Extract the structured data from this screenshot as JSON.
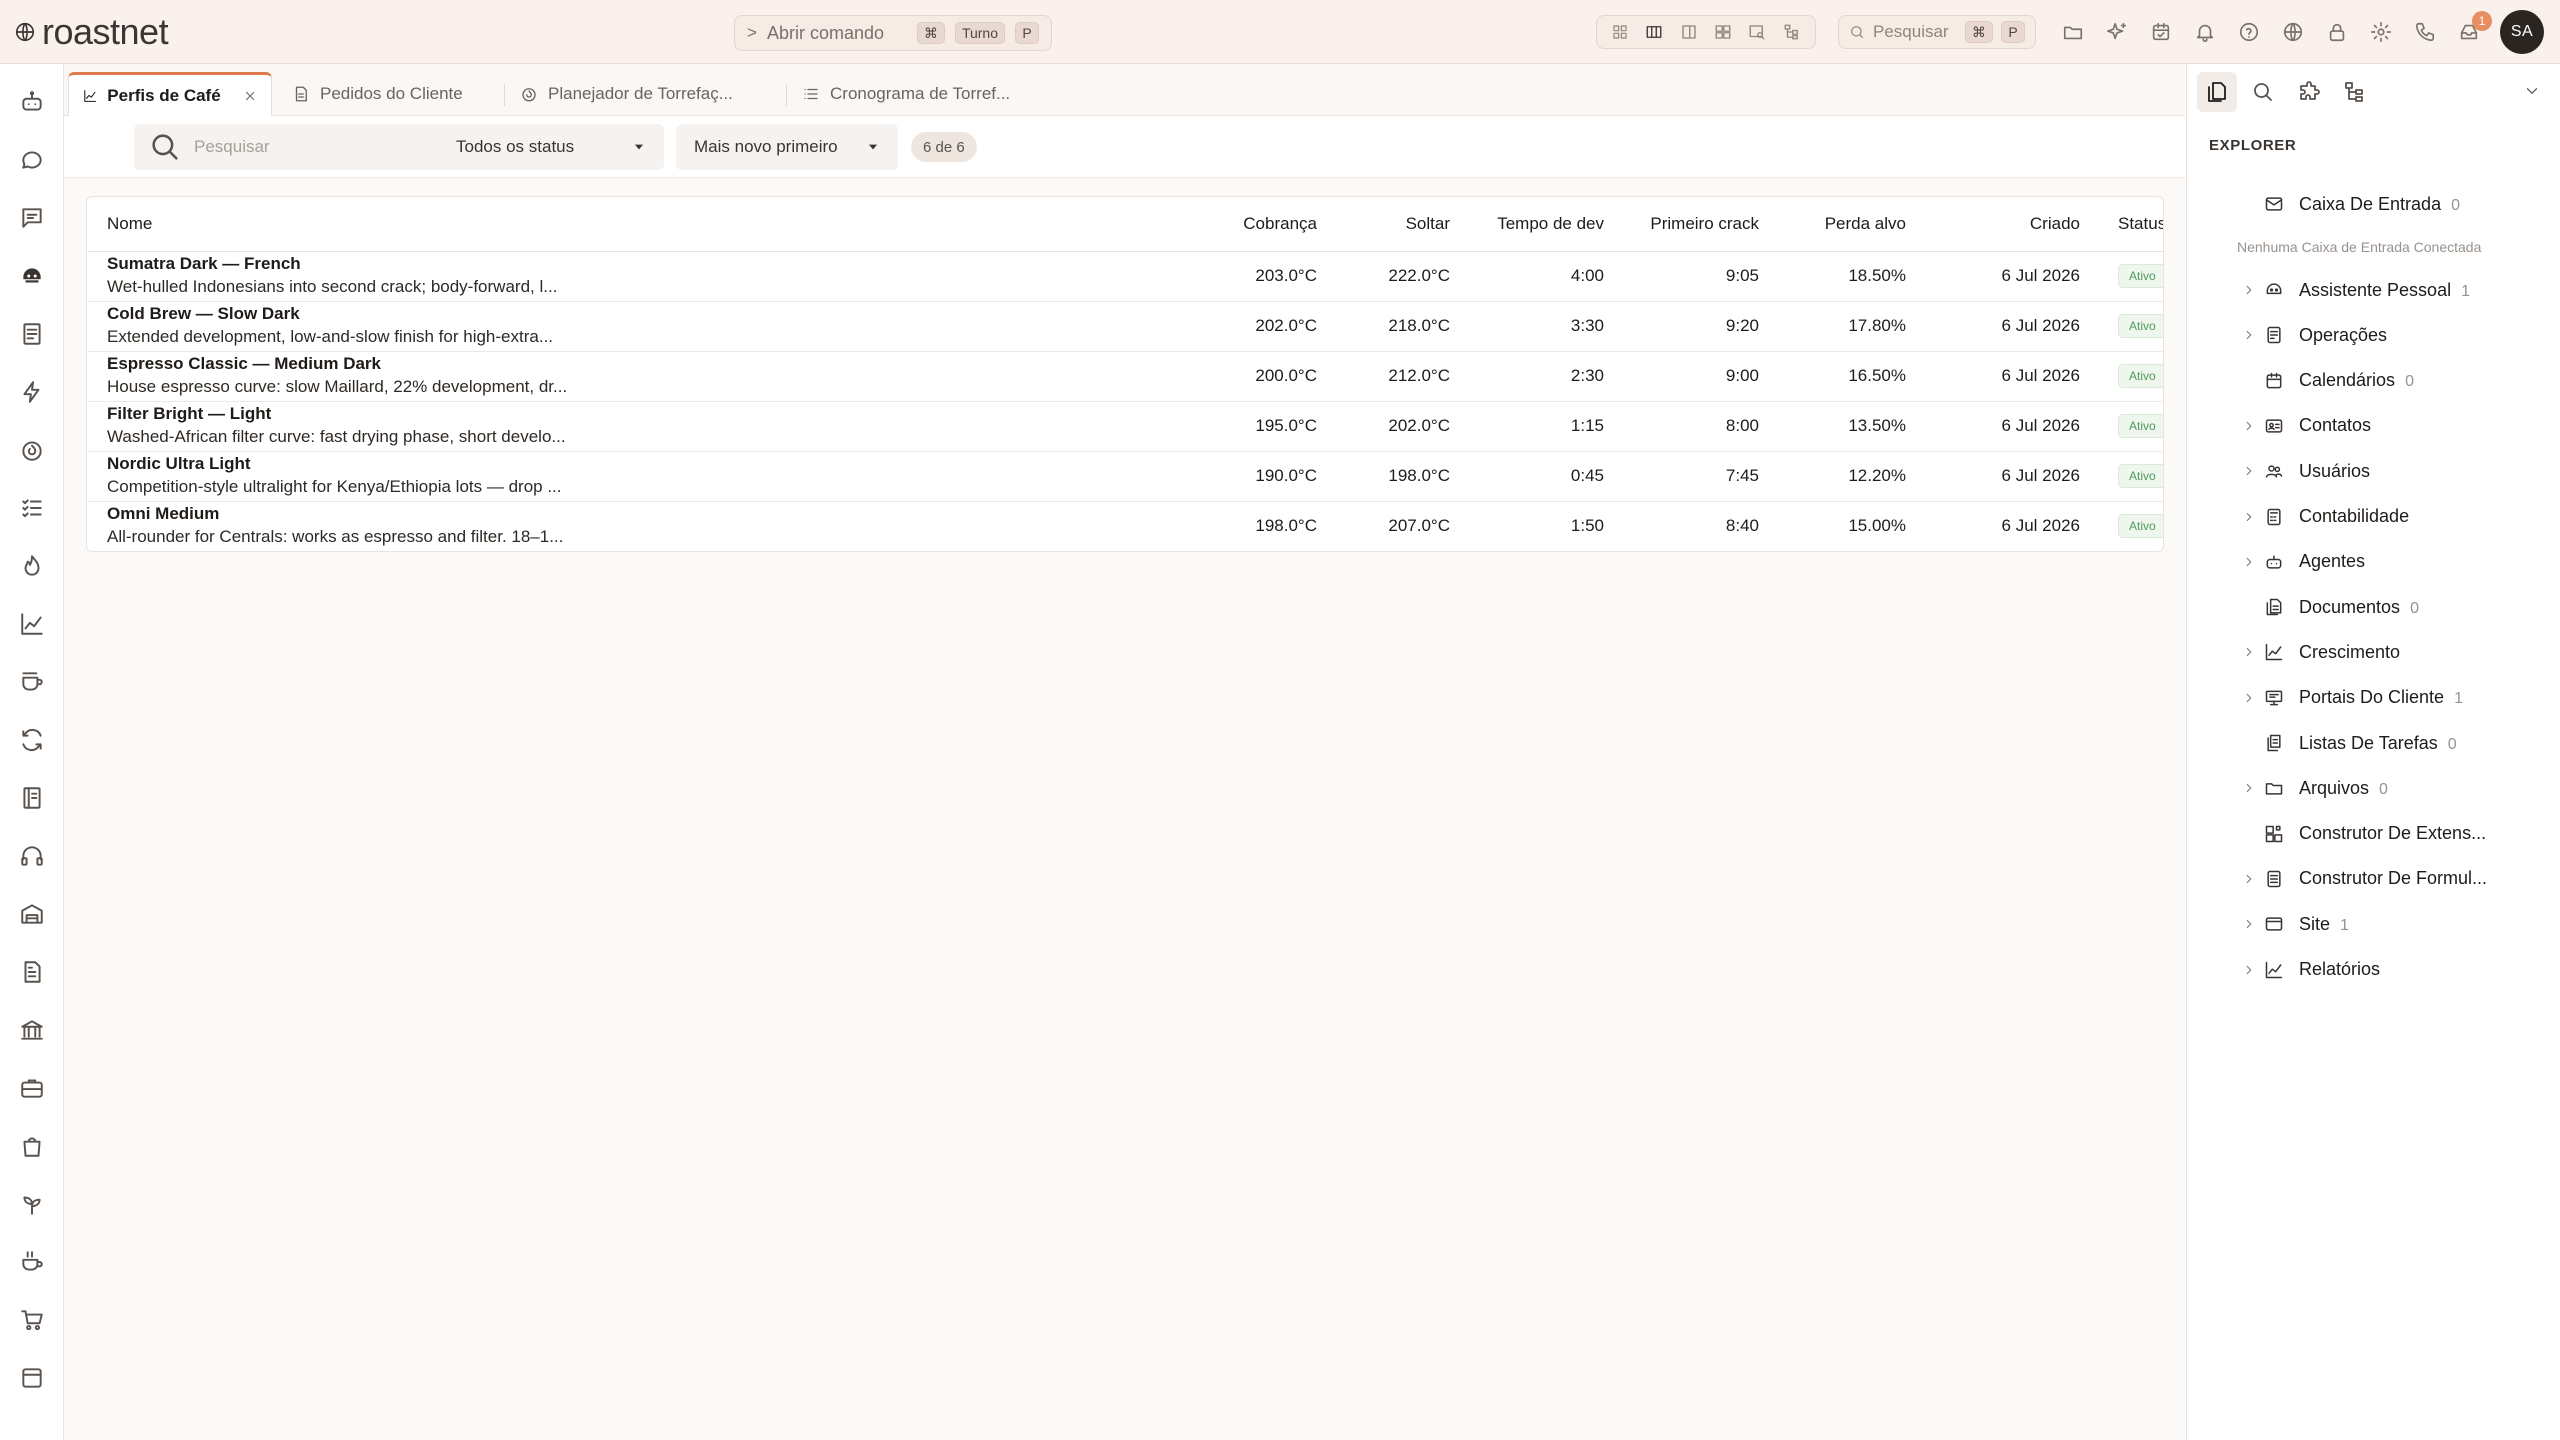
{
  "app": {
    "name": "roastnet",
    "brand_color": "#e07b4f",
    "user_initials": "SA",
    "notification_count": "1"
  },
  "command": {
    "prefix": ">",
    "label": "Abrir comando",
    "kbd1": "⌘",
    "kbd2": "Turno",
    "kbd3": "P"
  },
  "top_search": {
    "label": "Pesquisar",
    "kbd1": "⌘",
    "kbd2": "P"
  },
  "tabs": [
    {
      "label": "Perfis de Café",
      "icon": "chart-line-icon",
      "active": true
    },
    {
      "label": "Pedidos do Cliente",
      "icon": "document-icon",
      "active": false
    },
    {
      "label": "Planejador de Torrefaç...",
      "icon": "flame-icon",
      "active": false
    },
    {
      "label": "Cronograma de Torref...",
      "icon": "list-icon",
      "active": false
    }
  ],
  "filters": {
    "search_placeholder": "Pesquisar",
    "status_value": "Todos os status",
    "sort_value": "Mais novo primeiro",
    "count": "6 de 6"
  },
  "table": {
    "columns": [
      "Nome",
      "Cobrança",
      "Soltar",
      "Tempo de dev",
      "Primeiro crack",
      "Perda alvo",
      "Criado",
      "Status"
    ],
    "rows": [
      {
        "name": "Sumatra Dark — French",
        "desc": "Wet-hulled Indonesians into second crack; body-forward, l...",
        "charge": "203.0°C",
        "drop": "222.0°C",
        "dev": "4:00",
        "fc": "9:05",
        "loss": "18.50%",
        "created": "6 Jul 2026",
        "status": "Ativo"
      },
      {
        "name": "Cold Brew — Slow Dark",
        "desc": "Extended development, low-and-slow finish for high-extra...",
        "charge": "202.0°C",
        "drop": "218.0°C",
        "dev": "3:30",
        "fc": "9:20",
        "loss": "17.80%",
        "created": "6 Jul 2026",
        "status": "Ativo"
      },
      {
        "name": "Espresso Classic — Medium Dark",
        "desc": "House espresso curve: slow Maillard, 22% development, dr...",
        "charge": "200.0°C",
        "drop": "212.0°C",
        "dev": "2:30",
        "fc": "9:00",
        "loss": "16.50%",
        "created": "6 Jul 2026",
        "status": "Ativo"
      },
      {
        "name": "Filter Bright — Light",
        "desc": "Washed-African filter curve: fast drying phase, short develo...",
        "charge": "195.0°C",
        "drop": "202.0°C",
        "dev": "1:15",
        "fc": "8:00",
        "loss": "13.50%",
        "created": "6 Jul 2026",
        "status": "Ativo"
      },
      {
        "name": "Nordic Ultra Light",
        "desc": "Competition-style ultralight for Kenya/Ethiopia lots — drop ...",
        "charge": "190.0°C",
        "drop": "198.0°C",
        "dev": "0:45",
        "fc": "7:45",
        "loss": "12.20%",
        "created": "6 Jul 2026",
        "status": "Ativo"
      },
      {
        "name": "Omni Medium",
        "desc": "All-rounder for Centrals: works as espresso and filter. 18–1...",
        "charge": "198.0°C",
        "drop": "207.0°C",
        "dev": "1:50",
        "fc": "8:40",
        "loss": "15.00%",
        "created": "6 Jul 2026",
        "status": "Ativo"
      }
    ]
  },
  "explorer": {
    "heading": "EXPLORER",
    "inbox": {
      "label": "Caixa De Entrada",
      "count": "0"
    },
    "no_inbox_note": "Nenhuma Caixa de Entrada Conectada",
    "items": [
      {
        "label": "Assistente Pessoal",
        "count": "1",
        "icon": "robot-face-icon",
        "expandable": true
      },
      {
        "label": "Operações",
        "count": "",
        "icon": "server-icon",
        "expandable": true
      },
      {
        "label": "Calendários",
        "count": "0",
        "icon": "calendar-icon",
        "expandable": false
      },
      {
        "label": "Contatos",
        "count": "",
        "icon": "id-card-icon",
        "expandable": true
      },
      {
        "label": "Usuários",
        "count": "",
        "icon": "users-icon",
        "expandable": true
      },
      {
        "label": "Contabilidade",
        "count": "",
        "icon": "calculator-icon",
        "expandable": true
      },
      {
        "label": "Agentes",
        "count": "",
        "icon": "bot-icon",
        "expandable": true
      },
      {
        "label": "Documentos",
        "count": "0",
        "icon": "documents-icon",
        "expandable": false
      },
      {
        "label": "Crescimento",
        "count": "",
        "icon": "growth-chart-icon",
        "expandable": true
      },
      {
        "label": "Portais Do Cliente",
        "count": "1",
        "icon": "monitor-icon",
        "expandable": true
      },
      {
        "label": "Listas De Tarefas",
        "count": "0",
        "icon": "task-list-icon",
        "expandable": false
      },
      {
        "label": "Arquivos",
        "count": "0",
        "icon": "folder-icon",
        "expandable": true
      },
      {
        "label": "Construtor De Extens...",
        "count": "",
        "icon": "puzzle-grid-icon",
        "expandable": false
      },
      {
        "label": "Construtor De Formul...",
        "count": "",
        "icon": "form-icon",
        "expandable": true
      },
      {
        "label": "Site",
        "count": "1",
        "icon": "browser-icon",
        "expandable": true
      },
      {
        "label": "Relatórios",
        "count": "",
        "icon": "report-chart-icon",
        "expandable": true
      }
    ]
  }
}
